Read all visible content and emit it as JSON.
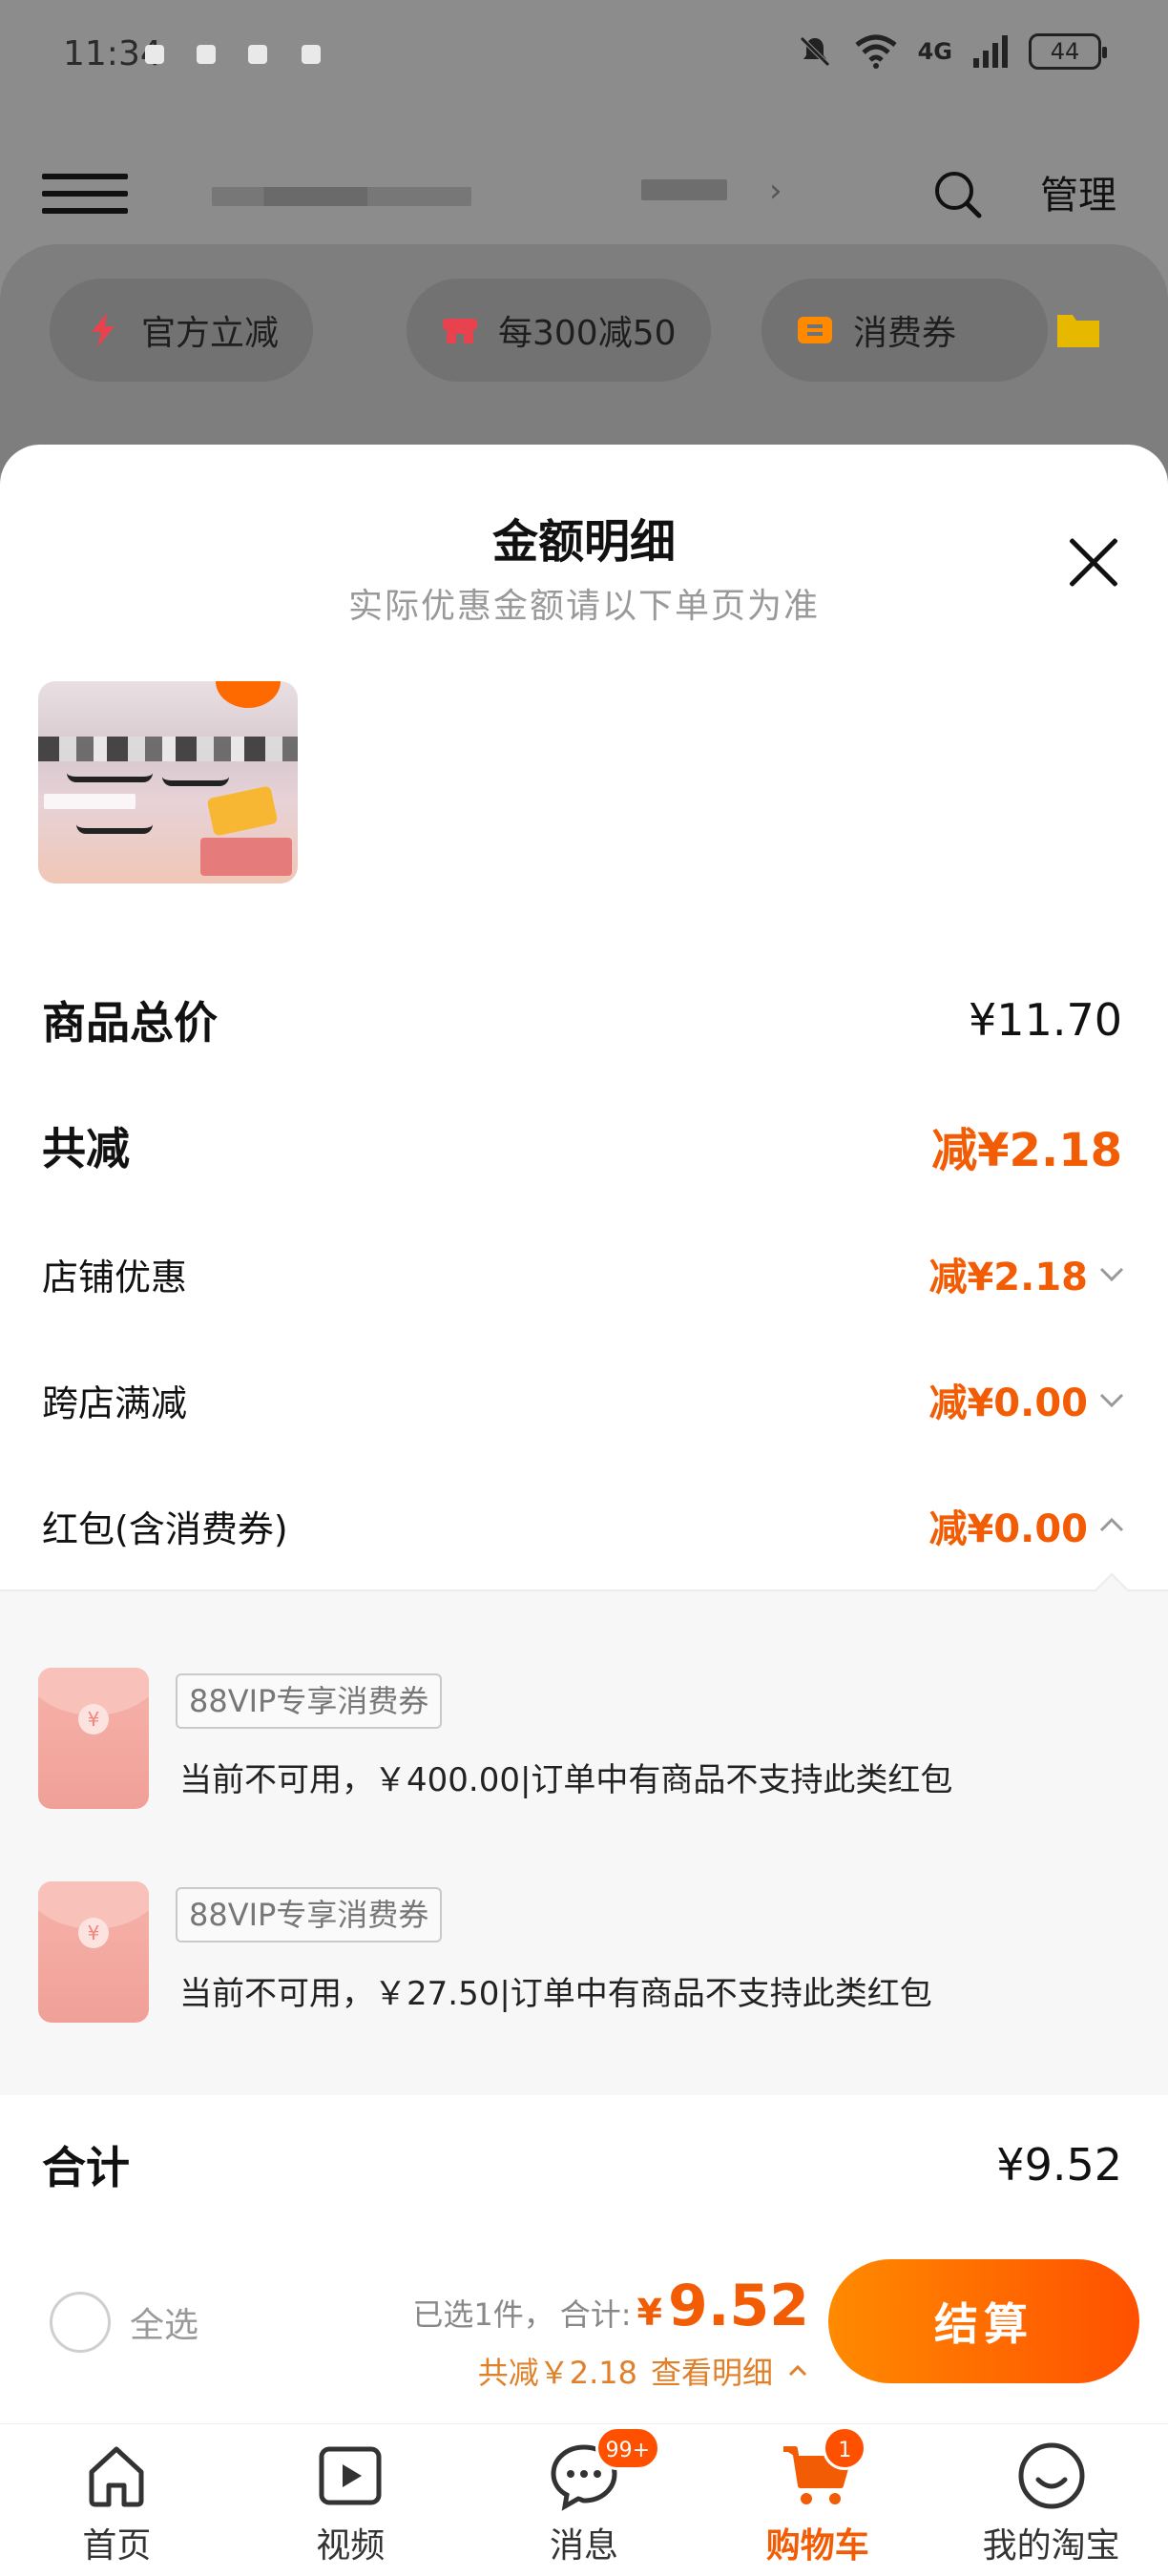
{
  "status_bar": {
    "time": "11:34",
    "network": "4G",
    "battery": "44"
  },
  "top_bar": {
    "manage_label": "管理"
  },
  "promo_chips": [
    {
      "label": "官方立减",
      "icon": "lightning-icon",
      "color": "#e8424f"
    },
    {
      "label": "每300减50",
      "icon": "shop-icon",
      "color": "#e8424f"
    },
    {
      "label": "消费券",
      "icon": "ticket-icon",
      "color": "#ff8a00"
    }
  ],
  "sheet": {
    "title": "金额明细",
    "subtitle": "实际优惠金额请以下单页为准",
    "rows": {
      "subtotal": {
        "label": "商品总价",
        "value": "¥11.70"
      },
      "total_discount": {
        "label": "共减",
        "value": "减¥2.18"
      },
      "shop_discount": {
        "label": "店铺优惠",
        "value": "减¥2.18"
      },
      "cross_shop": {
        "label": "跨店满减",
        "value": "减¥0.00"
      },
      "red_packet": {
        "label": "红包(含消费券)",
        "value": "减¥0.00"
      }
    },
    "coupons": [
      {
        "tag": "88VIP专享消费券",
        "desc": "当前不可用，￥400.00|订单中有商品不支持此类红包"
      },
      {
        "tag": "88VIP专享消费券",
        "desc": "当前不可用，￥27.50|订单中有商品不支持此类红包"
      }
    ],
    "total": {
      "label": "合计",
      "value": "¥9.52"
    }
  },
  "checkout": {
    "select_all": "全选",
    "selected_count": "已选1件，",
    "sum_label": "合计:",
    "sum_currency": "¥",
    "sum_value": "9.52",
    "discount_text": "共减￥2.18",
    "detail_link": "查看明细",
    "button": "结算"
  },
  "tabs": [
    {
      "label": "首页",
      "icon": "home-icon"
    },
    {
      "label": "视频",
      "icon": "video-icon"
    },
    {
      "label": "消息",
      "icon": "message-icon",
      "badge": "99+"
    },
    {
      "label": "购物车",
      "icon": "cart-icon",
      "badge": "1"
    },
    {
      "label": "我的淘宝",
      "icon": "profile-icon"
    }
  ],
  "colors": {
    "accent": "#f25c05",
    "button_gradient_start": "#ff8a00",
    "button_gradient_end": "#ff5000"
  }
}
